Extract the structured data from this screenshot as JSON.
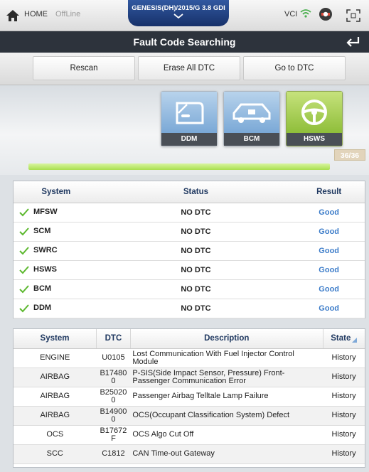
{
  "topbar": {
    "home_label": "HOME",
    "status": "OffLine",
    "vehicle": "GENESIS(DH)/2015/G 3.8 GDI",
    "vci_label": "VCI",
    "icons": [
      "home-icon",
      "chevron-down-icon",
      "wifi-icon",
      "vci-device-icon",
      "fullscreen-icon"
    ]
  },
  "title": "Fault Code Searching",
  "actions": {
    "rescan": "Rescan",
    "erase_all": "Erase All DTC",
    "go_to_dtc": "Go to DTC"
  },
  "system_tiles": [
    {
      "label": "DDM",
      "icon": "car-door-icon"
    },
    {
      "label": "BCM",
      "icon": "car-body-icon"
    },
    {
      "label": "HSWS",
      "icon": "steering-wheel-icon",
      "active": true
    }
  ],
  "progress": {
    "text": "36/36",
    "value": 36,
    "total": 36
  },
  "system_table": {
    "headers": {
      "system": "System",
      "status": "Status",
      "result": "Result"
    },
    "rows": [
      {
        "system": "MFSW",
        "status": "NO DTC",
        "result": "Good"
      },
      {
        "system": "SCM",
        "status": "NO DTC",
        "result": "Good"
      },
      {
        "system": "SWRC",
        "status": "NO DTC",
        "result": "Good"
      },
      {
        "system": "HSWS",
        "status": "NO DTC",
        "result": "Good"
      },
      {
        "system": "BCM",
        "status": "NO DTC",
        "result": "Good"
      },
      {
        "system": "DDM",
        "status": "NO DTC",
        "result": "Good"
      }
    ]
  },
  "dtc_table": {
    "headers": {
      "system": "System",
      "dtc": "DTC",
      "description": "Description",
      "state": "State"
    },
    "rows": [
      {
        "system": "ENGINE",
        "dtc": "U0105",
        "description": "Lost Communication With Fuel Injector Control Module",
        "state": "History"
      },
      {
        "system": "AIRBAG",
        "dtc": "B174800",
        "description": "P-SIS(Side Impact Sensor, Pressure) Front-Passenger Communication Error",
        "state": "History"
      },
      {
        "system": "AIRBAG",
        "dtc": "B250200",
        "description": "Passenger Airbag Telltale Lamp Failure",
        "state": "History"
      },
      {
        "system": "AIRBAG",
        "dtc": "B149000",
        "description": "OCS(Occupant Classification System) Defect",
        "state": "History"
      },
      {
        "system": "OCS",
        "dtc": "B17672F",
        "description": "OCS Algo Cut Off",
        "state": "History"
      },
      {
        "system": "SCC",
        "dtc": "C1812",
        "description": "CAN Time-out Gateway",
        "state": "History"
      }
    ]
  },
  "colors": {
    "title_bar": "#2d333c",
    "vehicle_tab": "#17316a",
    "good": "#3c7cc9",
    "check": "#5cb82e",
    "progress_fill": "#a9df50",
    "header_text": "#1f3860"
  }
}
